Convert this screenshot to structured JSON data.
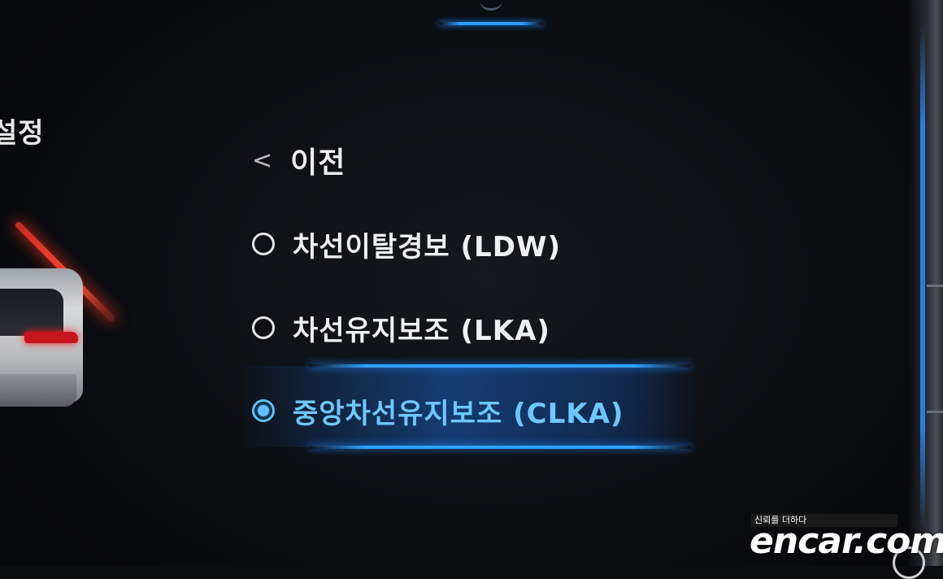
{
  "left_panel": {
    "title": "설정"
  },
  "menu": {
    "back": {
      "chevron": "<",
      "label": "이전"
    },
    "options": [
      {
        "label": "차선이탈경보 (LDW)",
        "selected": false
      },
      {
        "label": "차선유지보조 (LKA)",
        "selected": false
      },
      {
        "label": "중앙차선유지보조 (CLKA)",
        "selected": true
      }
    ]
  },
  "watermark": {
    "tagline": "신뢰를 더하다",
    "brand": "encar.com"
  },
  "colors": {
    "accent": "#2a9bff",
    "selected_text": "#6cc8ff",
    "lane_warning": "#ff3a20"
  },
  "icons": [
    "lane-line-icon",
    "car-icon",
    "steering-wheel-icon"
  ]
}
